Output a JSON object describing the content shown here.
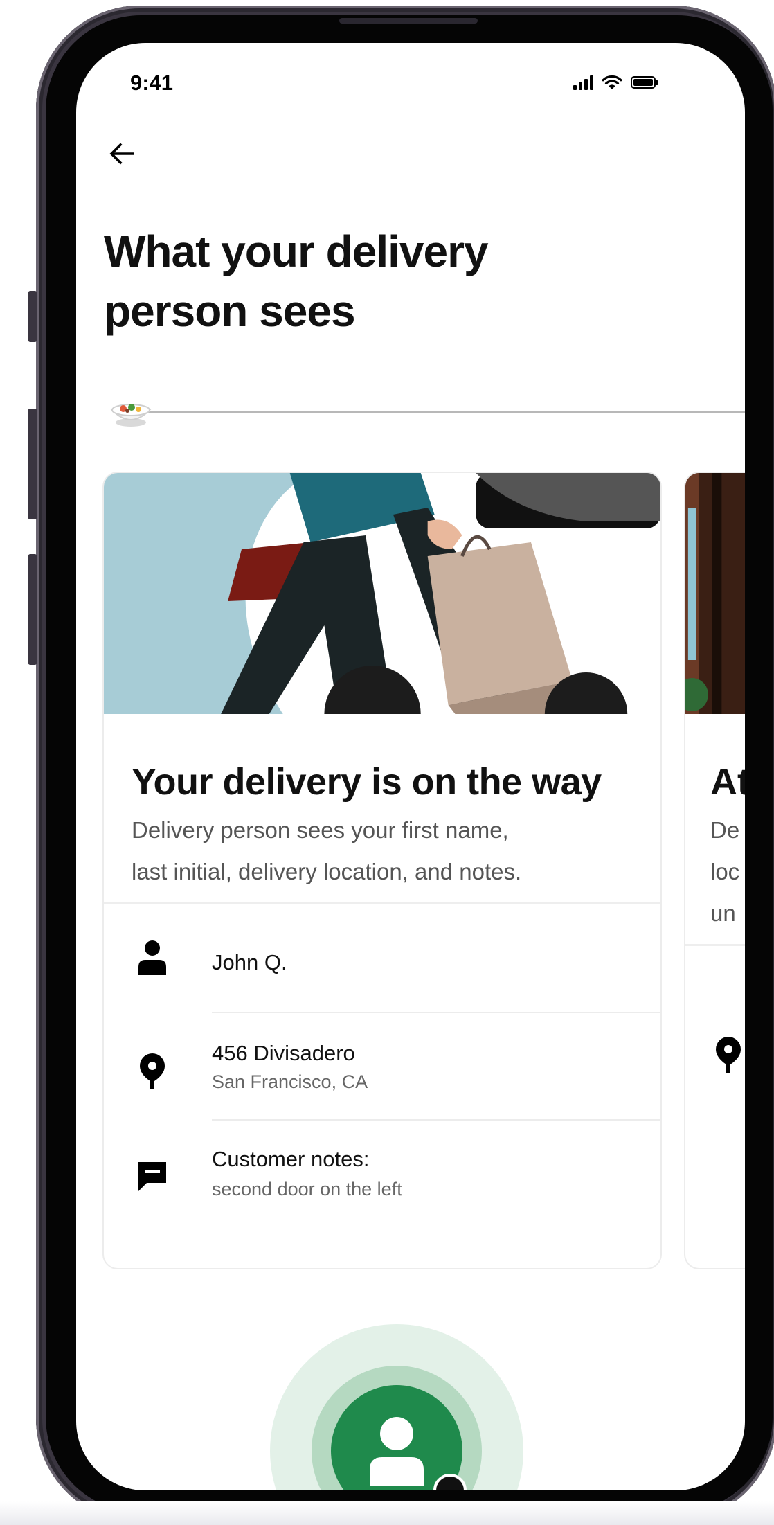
{
  "status_bar": {
    "time": "9:41"
  },
  "header": {
    "title_line1": "What your delivery",
    "title_line2": "person sees"
  },
  "cards": [
    {
      "title": "Your delivery is on the way",
      "description_line1": "Delivery person sees your first name,",
      "description_line2": "last initial, delivery location, and notes.",
      "rows": [
        {
          "icon": "person-icon",
          "primary": "John Q."
        },
        {
          "icon": "location-pin-icon",
          "primary": "456 Divisadero",
          "secondary": "San Francisco, CA"
        },
        {
          "icon": "message-icon",
          "primary": "Customer notes:",
          "secondary": "second door on the left"
        }
      ]
    },
    {
      "title": "At",
      "description_line1": "De",
      "description_line2": "loc",
      "description_line3": "un",
      "rows": [
        {
          "icon": "location-pin-icon"
        }
      ]
    }
  ],
  "colors": {
    "accent_green": "#1f8a4c",
    "text_primary": "#111111",
    "text_secondary": "#555555"
  }
}
